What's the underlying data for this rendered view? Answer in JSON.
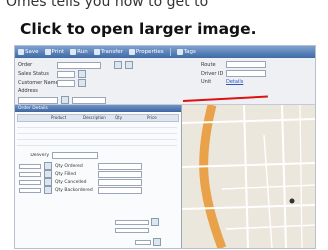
{
  "intro_text": "Omes tells you how to get to",
  "banner": {
    "text": "Click to open larger image."
  },
  "toolbar": {
    "items": [
      "Save",
      "Print",
      "Run",
      "Transfer",
      "Properties",
      "Tags"
    ]
  },
  "form": {
    "left_labels": [
      "Order",
      "Sales Status",
      "Customer Name",
      "Address"
    ],
    "left_values": [
      "",
      "",
      "",
      ""
    ],
    "right_labels": [
      "Route",
      "Driver ID",
      "Unit"
    ],
    "right_values": [
      "",
      "",
      ""
    ],
    "link_text": "Details"
  },
  "panel": {
    "title": "Order Details",
    "grid_columns": [
      "",
      "Product",
      "Description",
      "Qty",
      "Price"
    ],
    "section_label": "Delivery",
    "stats": [
      {
        "value": "",
        "label": "Qty Ordered"
      },
      {
        "value": "",
        "label": "Qty Filled"
      },
      {
        "value": "",
        "label": "Qty Cancelled"
      },
      {
        "value": "",
        "label": "Qty Backordered"
      }
    ],
    "bottom_values": [
      "",
      "",
      ""
    ]
  },
  "map": {
    "labels": [
      "",
      "",
      "",
      ""
    ],
    "colors": {
      "road_main": "#e9a24a",
      "road_minor": "#ffffff",
      "background": "#ece7dd"
    }
  }
}
